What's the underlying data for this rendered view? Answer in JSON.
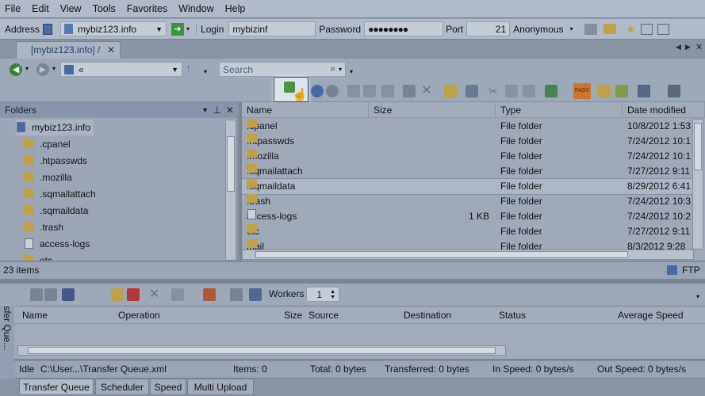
{
  "menu": [
    "File",
    "Edit",
    "View",
    "Tools",
    "Favorites",
    "Window",
    "Help"
  ],
  "address_bar": {
    "address_label": "Address",
    "address_value": "mybiz123.info",
    "login_label": "Login",
    "login_value": "mybizinf",
    "password_label": "Password",
    "password_value": "●●●●●●●●",
    "port_label": "Port",
    "port_value": "21",
    "anonymous_label": "Anonymous"
  },
  "tab": {
    "label": "[mybiz123.info] /"
  },
  "nav": {
    "path_value": "«",
    "search_placeholder": "Search"
  },
  "folders_panel": {
    "title": "Folders",
    "items": [
      {
        "label": "mybiz123.info",
        "kind": "server"
      },
      {
        "label": ".cpanel",
        "kind": "folder"
      },
      {
        "label": ".htpasswds",
        "kind": "folder"
      },
      {
        "label": ".mozilla",
        "kind": "folder"
      },
      {
        "label": ".sqmailattach",
        "kind": "folder"
      },
      {
        "label": ".sqmaildata",
        "kind": "folder"
      },
      {
        "label": ".trash",
        "kind": "folder"
      },
      {
        "label": "access-logs",
        "kind": "link"
      },
      {
        "label": "etc",
        "kind": "folder"
      }
    ]
  },
  "files_panel": {
    "columns": [
      "Name",
      "Size",
      "Type",
      "Date modified"
    ],
    "rows": [
      {
        "name": ".cpanel",
        "size": "",
        "type": "File folder",
        "date": "10/8/2012 1:53",
        "kind": "folder"
      },
      {
        "name": ".htpasswds",
        "size": "",
        "type": "File folder",
        "date": "7/24/2012 10:1",
        "kind": "folder"
      },
      {
        "name": ".mozilla",
        "size": "",
        "type": "File folder",
        "date": "7/24/2012 10:1",
        "kind": "folder"
      },
      {
        "name": ".sqmailattach",
        "size": "",
        "type": "File folder",
        "date": "7/27/2012 9:11",
        "kind": "folder"
      },
      {
        "name": ".sqmaildata",
        "size": "",
        "type": "File folder",
        "date": "8/29/2012 6:41",
        "kind": "folder"
      },
      {
        "name": ".trash",
        "size": "",
        "type": "File folder",
        "date": "7/24/2012 10:3",
        "kind": "folder"
      },
      {
        "name": "access-logs",
        "size": "1 KB",
        "type": "File folder",
        "date": "7/24/2012 10:2",
        "kind": "link"
      },
      {
        "name": "etc",
        "size": "",
        "type": "File folder",
        "date": "7/27/2012 9:11",
        "kind": "folder"
      },
      {
        "name": "mail",
        "size": "",
        "type": "File folder",
        "date": "8/3/2012 9:28",
        "kind": "folder"
      }
    ]
  },
  "status": {
    "items_count": "23 items",
    "protocol": "FTP"
  },
  "queue_toolbar": {
    "workers_label": "Workers",
    "workers_value": "1"
  },
  "queue_panel": {
    "side_label": "Transfer Que...",
    "columns": [
      "Name",
      "Operation",
      "Size",
      "Source",
      "Destination",
      "Status",
      "Average Speed"
    ]
  },
  "queue_status": {
    "state": "Idle",
    "file": "C:\\User...\\Transfer Queue.xml",
    "items": "Items: 0",
    "total": "Total: 0 bytes",
    "transferred": "Transferred: 0 bytes",
    "in_speed": "In Speed: 0 bytes/s",
    "out_speed": "Out Speed: 0 bytes/s"
  },
  "bottom_tabs": [
    "Transfer Queue",
    "Scheduler",
    "Speed",
    "Multi Upload"
  ],
  "colors": {
    "window_bg": "#a5b0c0",
    "folder": "#c9a84a",
    "highlight_button": "#e9eef6",
    "pasv_button": "#d97b2c"
  }
}
